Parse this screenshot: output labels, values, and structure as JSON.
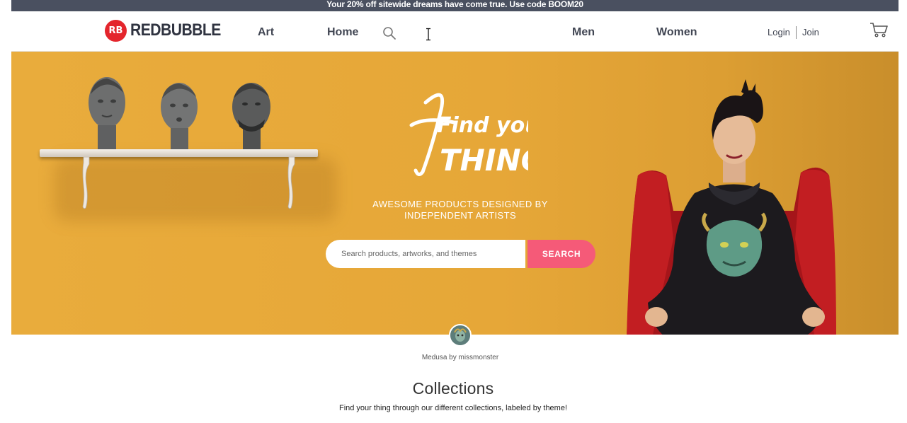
{
  "promo": {
    "prefix": "Your",
    "highlight": "20% off",
    "middle": "sitewide dreams have come true. Use code",
    "code": "BOOM20"
  },
  "header": {
    "logo_mark": "RB",
    "logo_text": "REDBUBBLE",
    "nav": [
      "Art",
      "Home",
      "Men",
      "Women"
    ],
    "login": "Login",
    "join": "Join"
  },
  "hero": {
    "headline_line1": "Find your",
    "headline_line2": "THING",
    "tagline_line1": "AWESOME PRODUCTS DESIGNED BY",
    "tagline_line2": "INDEPENDENT ARTISTS",
    "search_placeholder": "Search products, artworks, and themes",
    "search_button": "SEARCH"
  },
  "artist": {
    "credit": "Medusa by missmonster"
  },
  "collections": {
    "title": "Collections",
    "subtitle": "Find your thing through our different collections, labeled by theme!"
  },
  "colors": {
    "hero_bg": "#e7a83a",
    "search_button": "#f55a78",
    "brand_red": "#e4252c",
    "promo_bg": "#4a5060"
  },
  "icons": [
    "search-icon",
    "cart-icon",
    "text-cursor-icon"
  ]
}
